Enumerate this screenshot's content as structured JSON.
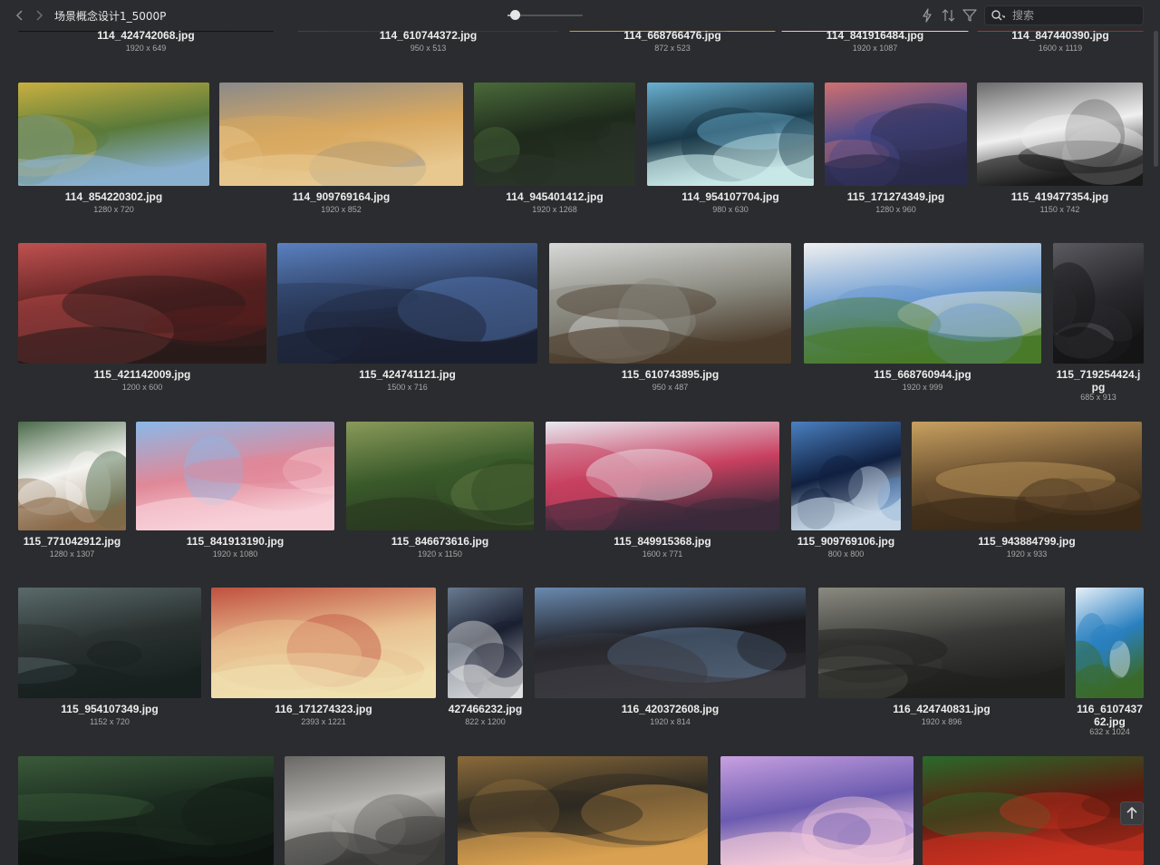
{
  "header": {
    "title": "场景概念设计1_5000P",
    "search_placeholder": "搜索",
    "zoom_percent": 10
  },
  "icons": {
    "back": "chevron-left-icon",
    "forward": "chevron-right-icon",
    "lightning": "lightning-icon",
    "sort": "sort-icon",
    "filter": "filter-icon",
    "search": "search-icon",
    "scroll_top": "arrow-up-icon"
  },
  "colors": {
    "background": "#2b2c2f",
    "text": "#ececec",
    "subtext": "#a8a8a8"
  },
  "rows": [
    {
      "items": [
        {
          "name": "114_424742068.jpg",
          "size": "1920 x 649"
        },
        {
          "name": "114_610744372.jpg",
          "size": "950 x 513"
        },
        {
          "name": "114_668766476.jpg",
          "size": "872 x 523"
        },
        {
          "name": "114_841916484.jpg",
          "size": "1920 x 1087"
        },
        {
          "name": "114_847440390.jpg",
          "size": "1600 x 1119"
        }
      ]
    },
    {
      "items": [
        {
          "name": "114_854220302.jpg",
          "size": "1280 x 720"
        },
        {
          "name": "114_909769164.jpg",
          "size": "1920 x 852"
        },
        {
          "name": "114_945401412.jpg",
          "size": "1920 x 1268"
        },
        {
          "name": "114_954107704.jpg",
          "size": "980 x 630"
        },
        {
          "name": "115_171274349.jpg",
          "size": "1280 x 960"
        },
        {
          "name": "115_419477354.jpg",
          "size": "1150 x 742"
        }
      ]
    },
    {
      "items": [
        {
          "name": "115_421142009.jpg",
          "size": "1200 x 600"
        },
        {
          "name": "115_424741121.jpg",
          "size": "1500 x 716"
        },
        {
          "name": "115_610743895.jpg",
          "size": "950 x 487"
        },
        {
          "name": "115_668760944.jpg",
          "size": "1920 x 999"
        },
        {
          "name": "115_719254424.jpg",
          "size": "685 x 913"
        }
      ]
    },
    {
      "items": [
        {
          "name": "115_771042912.jpg",
          "size": "1280 x 1307"
        },
        {
          "name": "115_841913190.jpg",
          "size": "1920 x 1080"
        },
        {
          "name": "115_846673616.jpg",
          "size": "1920 x 1150"
        },
        {
          "name": "115_849915368.jpg",
          "size": "1600 x 771"
        },
        {
          "name": "115_909769106.jpg",
          "size": "800 x 800"
        },
        {
          "name": "115_943884799.jpg",
          "size": "1920 x 933"
        }
      ]
    },
    {
      "items": [
        {
          "name": "115_954107349.jpg",
          "size": "1152 x 720"
        },
        {
          "name": "116_171274323.jpg",
          "size": "2393 x 1221"
        },
        {
          "name": "427466232.jpg",
          "size": "822 x 1200"
        },
        {
          "name": "116_420372608.jpg",
          "size": "1920 x 814"
        },
        {
          "name": "116_424740831.jpg",
          "size": "1920 x 896"
        },
        {
          "name": "116_610743762.jpg",
          "size": "632 x 1024"
        }
      ]
    },
    {
      "items": [
        {
          "name": "",
          "size": ""
        },
        {
          "name": "",
          "size": ""
        },
        {
          "name": "",
          "size": ""
        },
        {
          "name": "",
          "size": ""
        },
        {
          "name": "",
          "size": ""
        }
      ]
    }
  ]
}
